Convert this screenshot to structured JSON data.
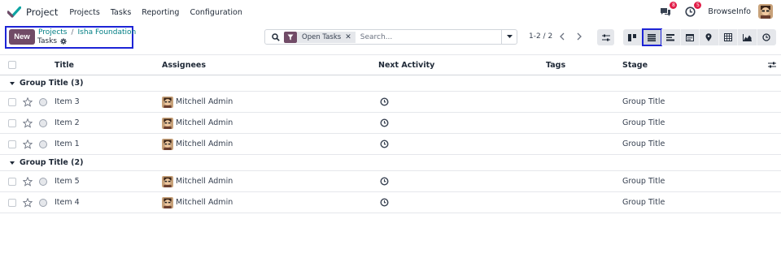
{
  "app": {
    "name": "Project"
  },
  "menu": [
    "Projects",
    "Tasks",
    "Reporting",
    "Configuration"
  ],
  "systray": {
    "messages_count": "8",
    "activities_count": "5",
    "company": "BrowseInfo"
  },
  "control": {
    "new_label": "New",
    "breadcrumb": [
      "Projects",
      "Isha Foundation"
    ],
    "current": "Tasks",
    "facet": "Open Tasks",
    "search_placeholder": "Search...",
    "pager": "1-2 / 2"
  },
  "columns": {
    "title": "Title",
    "assignees": "Assignees",
    "next_activity": "Next Activity",
    "tags": "Tags",
    "stage": "Stage"
  },
  "groups": [
    {
      "label": "Group Title (3)",
      "rows": [
        {
          "title": "Item 3",
          "assignee": "Mitchell Admin",
          "stage": "Group Title"
        },
        {
          "title": "Item 2",
          "assignee": "Mitchell Admin",
          "stage": "Group Title"
        },
        {
          "title": "Item 1",
          "assignee": "Mitchell Admin",
          "stage": "Group Title"
        }
      ]
    },
    {
      "label": "Group Title (2)",
      "rows": [
        {
          "title": "Item 5",
          "assignee": "Mitchell Admin",
          "stage": "Group Title"
        },
        {
          "title": "Item 4",
          "assignee": "Mitchell Admin",
          "stage": "Group Title"
        }
      ]
    }
  ],
  "colors": {
    "brand": "#714b67",
    "link": "#017e84",
    "highlight": "#1d24d6",
    "badge": "#e11d48"
  }
}
